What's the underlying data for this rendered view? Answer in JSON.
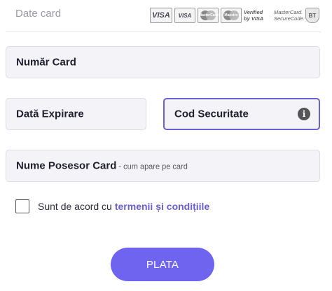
{
  "section": {
    "title": "Date card"
  },
  "logos": {
    "visa": "VISA",
    "visa_electron": "VISA",
    "mastercard": "MasterCard",
    "maestro": "Maestro",
    "verified_by_visa": [
      "Verified",
      "by VISA"
    ],
    "mastercard_securecode": [
      "MasterCard.",
      "SecureCode."
    ],
    "bt": "BT"
  },
  "form": {
    "card_number_label": "Număr Card",
    "expiry_label": "Dată Expirare",
    "cvv_label": "Cod Securitate",
    "holder_label": "Nume Posesor Card",
    "holder_hint": "- cum apare pe card"
  },
  "terms": {
    "text": "Sunt de acord cu",
    "link": "termenii și condițiile",
    "checked": false
  },
  "pay_button": {
    "label": "PLATA"
  },
  "colors": {
    "accent": "#6f64f0",
    "focus_border": "#6a5fd0",
    "field_bg": "#f3f3f8"
  },
  "icons": {
    "info": "info-icon"
  }
}
